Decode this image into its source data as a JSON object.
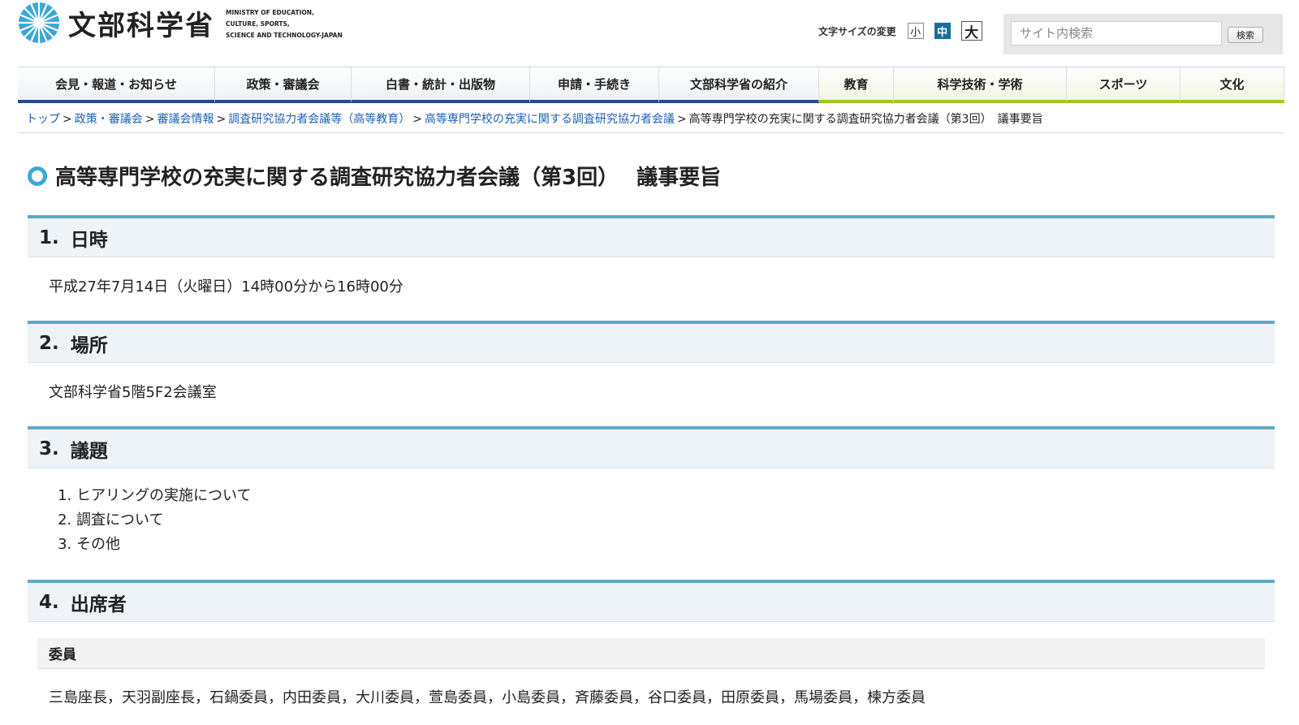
{
  "header": {
    "logo_ja": "文部科学省",
    "logo_en_lines": [
      "MINISTRY OF EDUCATION,",
      "CULTURE, SPORTS,",
      "SCIENCE AND TECHNOLOGY-JAPAN"
    ],
    "font_size_label": "文字サイズの変更",
    "font_sizes": [
      "小",
      "中",
      "大"
    ],
    "search_placeholder": "サイト内検索",
    "search_button": "検索",
    "logo_color": "#3aa8d8"
  },
  "nav": [
    {
      "label": "会見・報道・お知らせ",
      "color": "#1f4e8a"
    },
    {
      "label": "政策・審議会",
      "color": "#1f4e8a"
    },
    {
      "label": "白書・統計・出版物",
      "color": "#1f4e8a"
    },
    {
      "label": "申請・手続き",
      "color": "#1f4e8a"
    },
    {
      "label": "文部科学省の紹介",
      "color": "#1f4e8a"
    },
    {
      "label": "教育",
      "color": "#9dc81c"
    },
    {
      "label": "科学技術・学術",
      "color": "#9dc81c"
    },
    {
      "label": "スポーツ",
      "color": "#9dc81c"
    },
    {
      "label": "文化",
      "color": "#9dc81c"
    }
  ],
  "breadcrumb": {
    "links": [
      "トップ",
      "政策・審議会",
      "審議会情報",
      "調査研究協力者会議等（高等教育）",
      "高等専門学校の充実に関する調査研究協力者会議"
    ],
    "current": "高等専門学校の充実に関する調査研究協力者会議（第3回）　議事要旨"
  },
  "page_title": "高等専門学校の充実に関する調査研究協力者会議（第3回）　 議事要旨",
  "sections": [
    {
      "num": "1.",
      "title": "日時",
      "body": "平成27年7月14日（火曜日）14時00分から16時00分"
    },
    {
      "num": "2.",
      "title": "場所",
      "body": "文部科学省5階5F2会議室"
    },
    {
      "num": "3.",
      "title": "議題",
      "items": [
        "ヒアリングの実施について",
        "調査について",
        "その他"
      ]
    },
    {
      "num": "4.",
      "title": "出席者",
      "subhead": "委員",
      "body": "三島座長，天羽副座長，石鍋委員，内田委員，大川委員，萱島委員，小島委員，斉藤委員，谷口委員，田原委員，馬場委員，楝方委員"
    }
  ]
}
